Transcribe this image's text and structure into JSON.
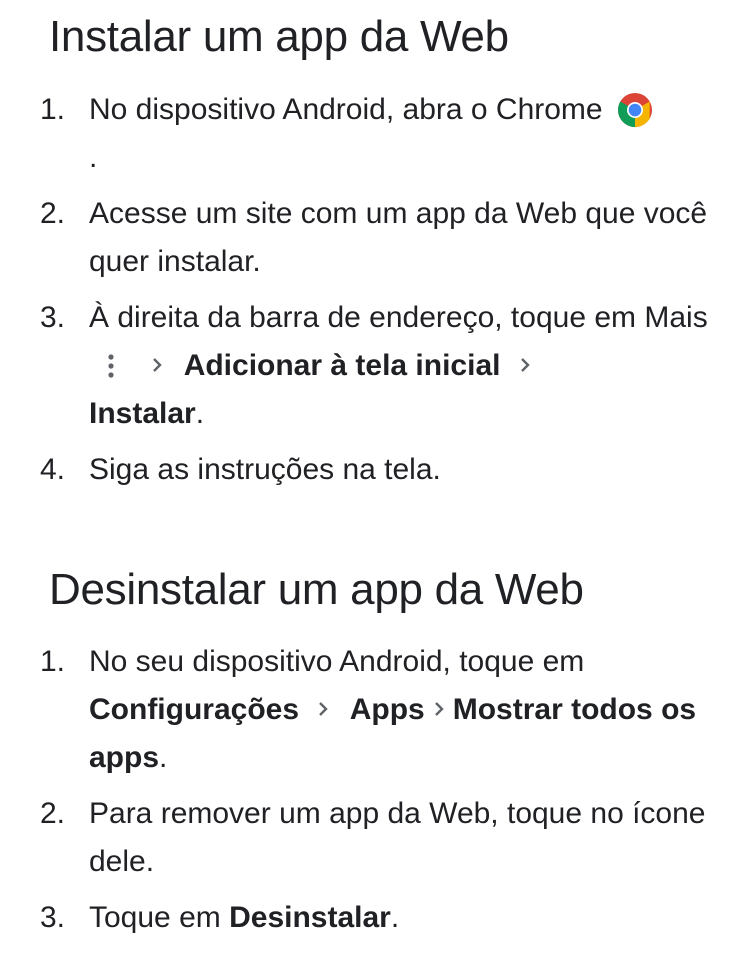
{
  "install": {
    "title": "Instalar um app da Web",
    "steps": [
      {
        "num": "1.",
        "text_a": "No dispositivo Android, abra o Chrome",
        "text_b": "."
      },
      {
        "num": "2.",
        "text_a": "Acesse um site com um app da Web que você quer instalar."
      },
      {
        "num": "3.",
        "text_a": "À direita da barra de endereço, toque em Mais",
        "bold_1": "Adicionar à tela inicial",
        "bold_2": "Instalar",
        "text_end": "."
      },
      {
        "num": "4.",
        "text_a": "Siga as instruções na tela."
      }
    ]
  },
  "uninstall": {
    "title": "Desinstalar um app da Web",
    "steps": [
      {
        "num": "1.",
        "text_a": "No seu dispositivo Android, toque em",
        "bold_1": "Configurações",
        "bold_2": "Apps",
        "bold_3": "Mostrar todos os apps",
        "text_end": "."
      },
      {
        "num": "2.",
        "text_a": "Para remover um app da Web, toque no ícone dele."
      },
      {
        "num": "3.",
        "text_a": "Toque em",
        "bold_1": "Desinstalar",
        "text_end": "."
      }
    ]
  },
  "icons": {
    "chrome": "chrome-icon",
    "more": "more-vert-icon",
    "separator": "chevron-right-icon"
  },
  "colors": {
    "text": "#202124",
    "icon_gray": "#5f6368",
    "chrome_red": "#db4437",
    "chrome_yellow": "#f4b400",
    "chrome_green": "#0f9d58",
    "chrome_blue": "#4285f4"
  }
}
